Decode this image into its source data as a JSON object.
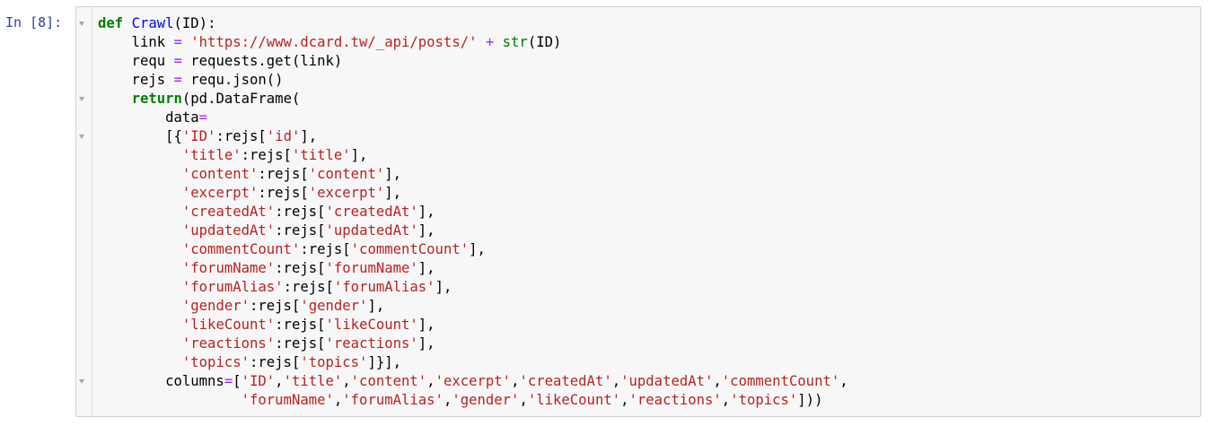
{
  "prompt": "In [8]:",
  "code_lines": [
    [
      {
        "t": "kw",
        "v": "def"
      },
      {
        "t": "plain",
        "v": " "
      },
      {
        "t": "def",
        "v": "Crawl"
      },
      {
        "t": "plain",
        "v": "(ID):"
      }
    ],
    [
      {
        "t": "plain",
        "v": "    link "
      },
      {
        "t": "op",
        "v": "="
      },
      {
        "t": "plain",
        "v": " "
      },
      {
        "t": "str",
        "v": "'https://www.dcard.tw/_api/posts/'"
      },
      {
        "t": "plain",
        "v": " "
      },
      {
        "t": "op",
        "v": "+"
      },
      {
        "t": "plain",
        "v": " "
      },
      {
        "t": "bi",
        "v": "str"
      },
      {
        "t": "plain",
        "v": "(ID)"
      }
    ],
    [
      {
        "t": "plain",
        "v": "    requ "
      },
      {
        "t": "op",
        "v": "="
      },
      {
        "t": "plain",
        "v": " requests.get(link)"
      }
    ],
    [
      {
        "t": "plain",
        "v": "    rejs "
      },
      {
        "t": "op",
        "v": "="
      },
      {
        "t": "plain",
        "v": " requ.json()"
      }
    ],
    [
      {
        "t": "plain",
        "v": "    "
      },
      {
        "t": "kw",
        "v": "return"
      },
      {
        "t": "plain",
        "v": "(pd.DataFrame("
      }
    ],
    [
      {
        "t": "plain",
        "v": "        data"
      },
      {
        "t": "op",
        "v": "="
      }
    ],
    [
      {
        "t": "plain",
        "v": "        [{"
      },
      {
        "t": "str",
        "v": "'ID'"
      },
      {
        "t": "plain",
        "v": ":rejs["
      },
      {
        "t": "str",
        "v": "'id'"
      },
      {
        "t": "plain",
        "v": "],"
      }
    ],
    [
      {
        "t": "plain",
        "v": "          "
      },
      {
        "t": "str",
        "v": "'title'"
      },
      {
        "t": "plain",
        "v": ":rejs["
      },
      {
        "t": "str",
        "v": "'title'"
      },
      {
        "t": "plain",
        "v": "],"
      }
    ],
    [
      {
        "t": "plain",
        "v": "          "
      },
      {
        "t": "str",
        "v": "'content'"
      },
      {
        "t": "plain",
        "v": ":rejs["
      },
      {
        "t": "str",
        "v": "'content'"
      },
      {
        "t": "plain",
        "v": "],"
      }
    ],
    [
      {
        "t": "plain",
        "v": "          "
      },
      {
        "t": "str",
        "v": "'excerpt'"
      },
      {
        "t": "plain",
        "v": ":rejs["
      },
      {
        "t": "str",
        "v": "'excerpt'"
      },
      {
        "t": "plain",
        "v": "],"
      }
    ],
    [
      {
        "t": "plain",
        "v": "          "
      },
      {
        "t": "str",
        "v": "'createdAt'"
      },
      {
        "t": "plain",
        "v": ":rejs["
      },
      {
        "t": "str",
        "v": "'createdAt'"
      },
      {
        "t": "plain",
        "v": "],"
      }
    ],
    [
      {
        "t": "plain",
        "v": "          "
      },
      {
        "t": "str",
        "v": "'updatedAt'"
      },
      {
        "t": "plain",
        "v": ":rejs["
      },
      {
        "t": "str",
        "v": "'updatedAt'"
      },
      {
        "t": "plain",
        "v": "],"
      }
    ],
    [
      {
        "t": "plain",
        "v": "          "
      },
      {
        "t": "str",
        "v": "'commentCount'"
      },
      {
        "t": "plain",
        "v": ":rejs["
      },
      {
        "t": "str",
        "v": "'commentCount'"
      },
      {
        "t": "plain",
        "v": "],"
      }
    ],
    [
      {
        "t": "plain",
        "v": "          "
      },
      {
        "t": "str",
        "v": "'forumName'"
      },
      {
        "t": "plain",
        "v": ":rejs["
      },
      {
        "t": "str",
        "v": "'forumName'"
      },
      {
        "t": "plain",
        "v": "],"
      }
    ],
    [
      {
        "t": "plain",
        "v": "          "
      },
      {
        "t": "str",
        "v": "'forumAlias'"
      },
      {
        "t": "plain",
        "v": ":rejs["
      },
      {
        "t": "str",
        "v": "'forumAlias'"
      },
      {
        "t": "plain",
        "v": "],"
      }
    ],
    [
      {
        "t": "plain",
        "v": "          "
      },
      {
        "t": "str",
        "v": "'gender'"
      },
      {
        "t": "plain",
        "v": ":rejs["
      },
      {
        "t": "str",
        "v": "'gender'"
      },
      {
        "t": "plain",
        "v": "],"
      }
    ],
    [
      {
        "t": "plain",
        "v": "          "
      },
      {
        "t": "str",
        "v": "'likeCount'"
      },
      {
        "t": "plain",
        "v": ":rejs["
      },
      {
        "t": "str",
        "v": "'likeCount'"
      },
      {
        "t": "plain",
        "v": "],"
      }
    ],
    [
      {
        "t": "plain",
        "v": "          "
      },
      {
        "t": "str",
        "v": "'reactions'"
      },
      {
        "t": "plain",
        "v": ":rejs["
      },
      {
        "t": "str",
        "v": "'reactions'"
      },
      {
        "t": "plain",
        "v": "],"
      }
    ],
    [
      {
        "t": "plain",
        "v": "          "
      },
      {
        "t": "str",
        "v": "'topics'"
      },
      {
        "t": "plain",
        "v": ":rejs["
      },
      {
        "t": "str",
        "v": "'topics'"
      },
      {
        "t": "plain",
        "v": "]}],"
      }
    ],
    [
      {
        "t": "plain",
        "v": "        columns"
      },
      {
        "t": "op",
        "v": "="
      },
      {
        "t": "plain",
        "v": "["
      },
      {
        "t": "str",
        "v": "'ID'"
      },
      {
        "t": "plain",
        "v": ","
      },
      {
        "t": "str",
        "v": "'title'"
      },
      {
        "t": "plain",
        "v": ","
      },
      {
        "t": "str",
        "v": "'content'"
      },
      {
        "t": "plain",
        "v": ","
      },
      {
        "t": "str",
        "v": "'excerpt'"
      },
      {
        "t": "plain",
        "v": ","
      },
      {
        "t": "str",
        "v": "'createdAt'"
      },
      {
        "t": "plain",
        "v": ","
      },
      {
        "t": "str",
        "v": "'updatedAt'"
      },
      {
        "t": "plain",
        "v": ","
      },
      {
        "t": "str",
        "v": "'commentCount'"
      },
      {
        "t": "plain",
        "v": ","
      }
    ],
    [
      {
        "t": "plain",
        "v": "                 "
      },
      {
        "t": "str",
        "v": "'forumName'"
      },
      {
        "t": "plain",
        "v": ","
      },
      {
        "t": "str",
        "v": "'forumAlias'"
      },
      {
        "t": "plain",
        "v": ","
      },
      {
        "t": "str",
        "v": "'gender'"
      },
      {
        "t": "plain",
        "v": ","
      },
      {
        "t": "str",
        "v": "'likeCount'"
      },
      {
        "t": "plain",
        "v": ","
      },
      {
        "t": "str",
        "v": "'reactions'"
      },
      {
        "t": "plain",
        "v": ","
      },
      {
        "t": "str",
        "v": "'topics'"
      },
      {
        "t": "plain",
        "v": "]))"
      }
    ]
  ],
  "fold_marker_lines": [
    0,
    4,
    6,
    19
  ],
  "colors": {
    "prompt": "#303f9f",
    "keyword": "#008000",
    "definition": "#0000ff",
    "string": "#ba2121",
    "operator": "#aa22ff",
    "builtin": "#008000",
    "cell_background": "#f7f7f7",
    "cell_border": "#cfcfcf"
  },
  "icons": {
    "fold_marker": "fold-triangle-icon"
  }
}
